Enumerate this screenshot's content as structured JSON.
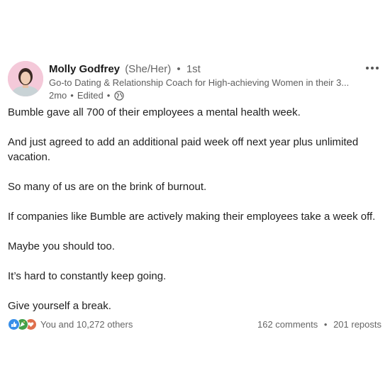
{
  "author": {
    "name": "Molly Godfrey",
    "pronouns": "(She/Her)",
    "separator": "•",
    "connection_degree": "1st",
    "headline": "Go-to Dating & Relationship Coach for High-achieving Women in their 3...",
    "time_ago": "2mo",
    "edited": "Edited",
    "visibility_icon": "globe-icon"
  },
  "menu": {
    "icon": "more-dots-icon"
  },
  "post": {
    "paragraphs": [
      "Bumble gave all 700 of their employees a mental health week.",
      "And just agreed to add an additional paid week off next year plus unlimited vacation.",
      "So many of us are on the brink of burnout.",
      "If companies like Bumble are actively making their employees take a week off.",
      "Maybe you should too.",
      "It’s hard to constantly keep going.",
      "Give yourself a break."
    ]
  },
  "social": {
    "reaction_icons": [
      "like-icon",
      "celebrate-icon",
      "love-icon"
    ],
    "reaction_colors": [
      "#378fe9",
      "#44a04a",
      "#df704d"
    ],
    "reactions_text": "You and 10,272 others",
    "comments": "162 comments",
    "separator": "•",
    "reposts": "201 reposts"
  }
}
